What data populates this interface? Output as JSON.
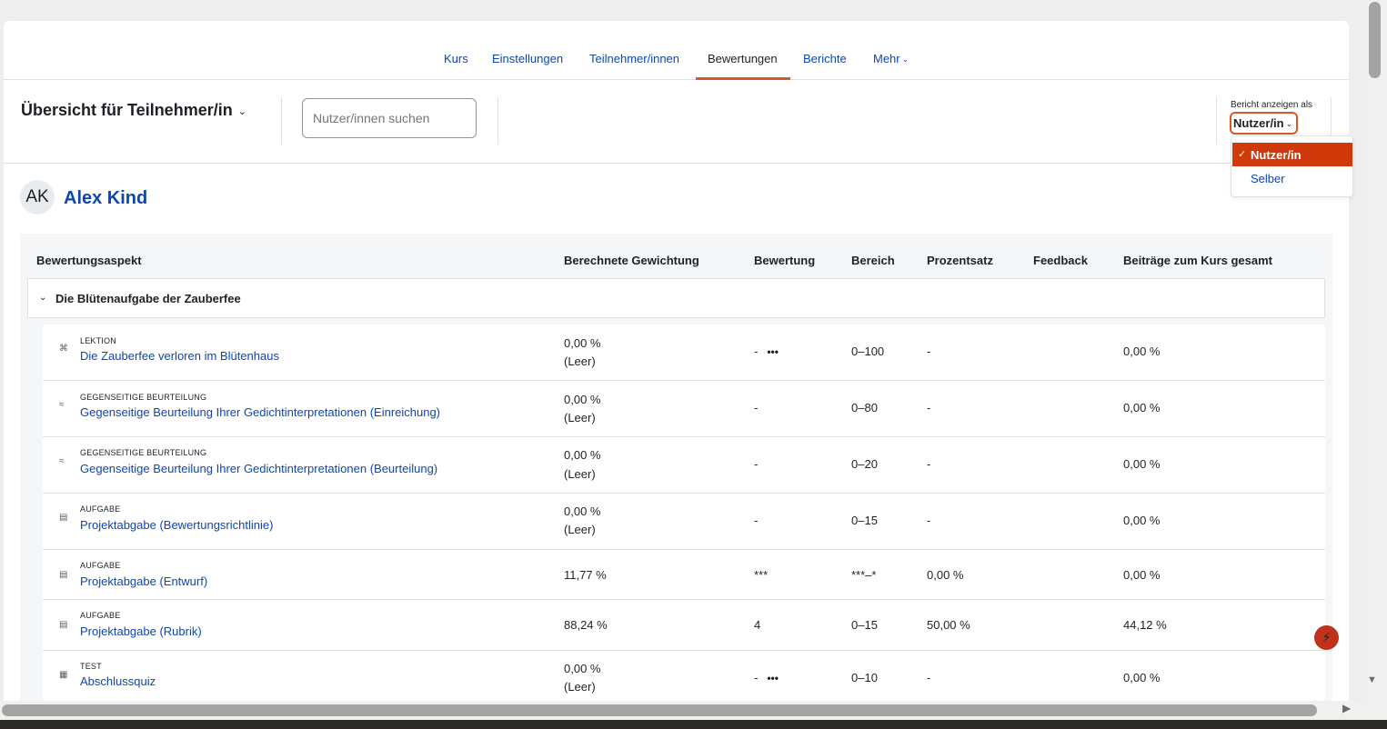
{
  "nav": {
    "tabs": [
      {
        "label": "Kurs"
      },
      {
        "label": "Einstellungen"
      },
      {
        "label": "Teilnehmer/innen"
      },
      {
        "label": "Bewertungen"
      },
      {
        "label": "Berichte"
      },
      {
        "label": "Mehr"
      }
    ],
    "active": "Bewertungen"
  },
  "toolbar": {
    "report_title": "Übersicht für Teilnehmer/in",
    "search_placeholder": "Nutzer/innen suchen",
    "view_label": "Bericht anzeigen als",
    "view_value": "Nutzer/in"
  },
  "dropdown": {
    "options": [
      "Nutzer/in",
      "Selber"
    ],
    "selected": "Nutzer/in"
  },
  "user": {
    "initials": "AK",
    "name": "Alex Kind"
  },
  "table": {
    "headers": [
      "Bewertungsaspekt",
      "Berechnete Gewichtung",
      "Bewertung",
      "Bereich",
      "Prozentsatz",
      "Feedback",
      "Beiträge zum Kurs gesamt"
    ],
    "category": "Die Blütenaufgabe der Zauberfee",
    "rows": [
      {
        "type": "LEKTION",
        "name": "Die Zauberfee verloren im Blütenhaus",
        "weight": "0,00 %",
        "weight_note": "(Leer)",
        "grade": "-",
        "range": "0–100",
        "percent": "-",
        "feedback": "",
        "contribution": "0,00 %"
      },
      {
        "type": "GEGENSEITIGE BEURTEILUNG",
        "name": "Gegenseitige Beurteilung Ihrer Gedichtinterpretationen (Einreichung)",
        "weight": "0,00 %",
        "weight_note": "(Leer)",
        "grade": "-",
        "range": "0–80",
        "percent": "-",
        "feedback": "",
        "contribution": "0,00 %"
      },
      {
        "type": "GEGENSEITIGE BEURTEILUNG",
        "name": "Gegenseitige Beurteilung Ihrer Gedichtinterpretationen (Beurteilung)",
        "weight": "0,00 %",
        "weight_note": "(Leer)",
        "grade": "-",
        "range": "0–20",
        "percent": "-",
        "feedback": "",
        "contribution": "0,00 %"
      },
      {
        "type": "AUFGABE",
        "name": "Projektabgabe (Bewertungsrichtlinie)",
        "weight": "0,00 %",
        "weight_note": "(Leer)",
        "grade": "-",
        "range": "0–15",
        "percent": "-",
        "feedback": "",
        "contribution": "0,00 %"
      },
      {
        "type": "AUFGABE",
        "name": "Projektabgabe (Entwurf)",
        "weight": "11,77 %",
        "weight_note": "",
        "grade": "***",
        "range": "***–*",
        "percent": "0,00 %",
        "feedback": "",
        "contribution": "0,00 %"
      },
      {
        "type": "AUFGABE",
        "name": "Projektabgabe (Rubrik)",
        "weight": "88,24 %",
        "weight_note": "",
        "grade": "4",
        "range": "0–15",
        "percent": "50,00 %",
        "feedback": "",
        "contribution": "44,12 %"
      },
      {
        "type": "TEST",
        "name": "Abschlussquiz",
        "weight": "0,00 %",
        "weight_note": "(Leer)",
        "grade": "-",
        "range": "0–10",
        "percent": "-",
        "feedback": "",
        "contribution": "0,00 %"
      }
    ]
  },
  "colors": {
    "accent": "#d8562c",
    "link": "#0f47ad",
    "selected_bg": "#d03a0a"
  }
}
